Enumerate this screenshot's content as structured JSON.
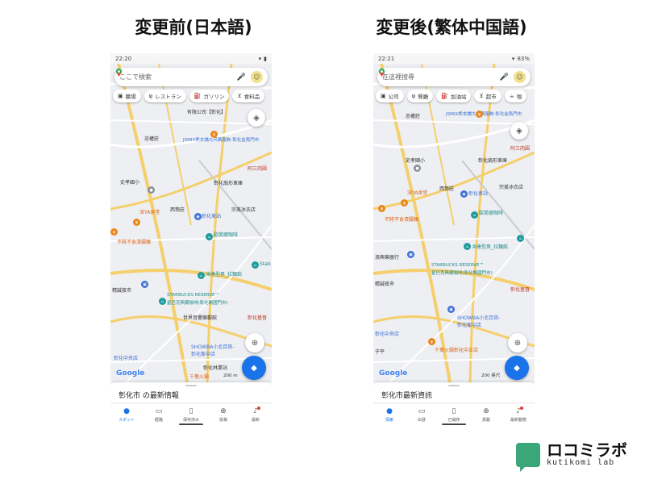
{
  "left": {
    "heading": "変更前(日本語)",
    "status_time": "22:20",
    "search_placeholder": "ここで検索",
    "chips": [
      {
        "icon": "briefcase-icon",
        "label": "職場"
      },
      {
        "icon": "fork-knife-icon",
        "label": "レストラン"
      },
      {
        "icon": "gas-pump-icon",
        "label": "ガソリン"
      },
      {
        "icon": "cart-icon",
        "label": "食料品"
      }
    ],
    "map_labels": {
      "l1": "有限公司【彰化】",
      "l2": "JSMIX熊本舖大尺碼服飾-彰化金馬門市",
      "l3": "忠權莊",
      "l4": "史孝國小",
      "l5": "西勢莊",
      "l6": "彰化車站",
      "l7": "宗美冰衣店",
      "l8": "深YA食堂",
      "l9": "不將不食清腸麵",
      "l10": "歐笑娜咖啡",
      "l11": "彰化扇形車庫",
      "l12": "阿三肉圓",
      "l13": "沖達型男_拉麵館",
      "l14": "Stab",
      "l15": "精誠夜市",
      "l16": "STARBUCKS RESERVE™",
      "l17": "星巴克典藏咖啡(彰化鴨國門市)",
      "l18": "世界音響樂觀館",
      "l19": "彰化基督",
      "l20": "SHOWBA小北百貨-彰化衛中店",
      "l21": "彰化中央店",
      "l22": "千葉火鍋",
      "l23": "彰化林業站"
    },
    "scale": "200 m",
    "sheet_title": "彰化市 の最新情報",
    "nav": [
      {
        "icon": "location-pin-icon",
        "label": "スポット",
        "active": true
      },
      {
        "icon": "car-icon",
        "label": "経路",
        "active": false
      },
      {
        "icon": "bookmark-icon",
        "label": "保存済み",
        "active": false
      },
      {
        "icon": "plus-circle-icon",
        "label": "投稿",
        "active": false
      },
      {
        "icon": "bell-icon",
        "label": "最新",
        "active": false
      }
    ]
  },
  "right": {
    "heading": "変更後(繁体中国語)",
    "status_time": "22:21",
    "status_battery": "83%",
    "search_placeholder": "在這裡搜尋",
    "chips": [
      {
        "icon": "briefcase-icon",
        "label": "公司"
      },
      {
        "icon": "fork-knife-icon",
        "label": "餐廳"
      },
      {
        "icon": "gas-pump-icon",
        "label": "加油站"
      },
      {
        "icon": "cart-icon",
        "label": "超市"
      },
      {
        "icon": "coffee-icon",
        "label": "咖"
      }
    ],
    "map_labels": {
      "l1": "JSMIX熊本舖大尺碼服飾-彰化金馬門市",
      "l2": "忠權莊",
      "l3": "史孝國小",
      "l4": "西勢莊",
      "l5": "彰化車站",
      "l6": "宗美冰衣店",
      "l7": "深YA食堂",
      "l8": "不將不食清腸麵",
      "l9": "歐笑娜咖啡",
      "l10": "彰化扇形車庫",
      "l11": "阿三肉圓",
      "l12": "沖達型男_拉麵館",
      "l13": "浪興樂器行",
      "l14": "精誠夜市",
      "l15": "STARBUCKS RESERVE™",
      "l16": "星巴克典藏咖啡(彰化鴨國門市)",
      "l17": "彰化基督",
      "l18": "SHOWBA小北百貨-彰化衛中店",
      "l19": "彰化中央店",
      "l20": "千葉火鍋彰化中正店",
      "l21": "子平"
    },
    "scale": "200 英尺",
    "sheet_title": "彰化市最新資訊",
    "nav": [
      {
        "icon": "location-pin-icon",
        "label": "探索",
        "active": true
      },
      {
        "icon": "car-icon",
        "label": "出發",
        "active": false
      },
      {
        "icon": "bookmark-icon",
        "label": "已儲存",
        "active": false
      },
      {
        "icon": "plus-circle-icon",
        "label": "貢獻",
        "active": false
      },
      {
        "icon": "bell-icon",
        "label": "最新動態",
        "active": false
      }
    ]
  },
  "common": {
    "google": "Google"
  },
  "logo": {
    "title": "ロコミラボ",
    "subtitle": "kutikomi lab"
  },
  "colors": {
    "accent": "#1a73e8",
    "brand_green": "#3aa67a",
    "road_yellow": "#f5cf6c",
    "map_bg": "#eeeff2"
  }
}
